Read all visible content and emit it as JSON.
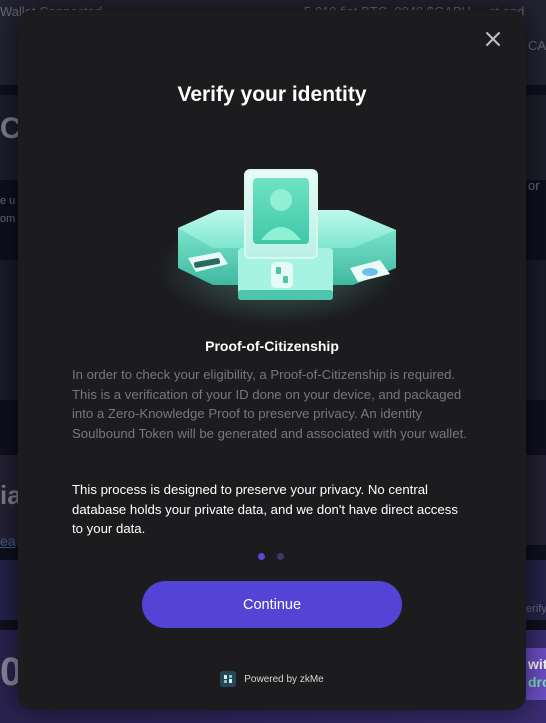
{
  "background": {
    "top_left": "Wallet Connected",
    "top_right": "5,019 fiat BTC, 0040 $GAPU ... ct and",
    "top_right2": "CA",
    "big_letter1": "C",
    "side_text1": "e u",
    "side_text2": "om",
    "right_text": "or",
    "big_letter2": "ia",
    "link_text": "ea",
    "right_text2": "erify",
    "big_number": "0",
    "purple_text1": "wit",
    "purple_text2": "dro"
  },
  "modal": {
    "title": "Verify your identity",
    "subtitle": "Proof-of-Citizenship",
    "description": "In order to check your eligibility, a Proof-of-Citizenship is required. This is a verification of your ID done on your device, and packaged into a Zero-Knowledge Proof to preserve privacy. An identity Soulbound Token will be generated and associated with your wallet.",
    "privacy_note": "This process is designed to preserve your privacy. No central database holds your private data, and we don't have direct access to your data.",
    "pagination": {
      "current": 1,
      "total": 2
    },
    "continue_label": "Continue",
    "powered_by": "Powered by zkMe",
    "colors": {
      "accent": "#5444d6",
      "modal_bg": "#1c1c1e",
      "illustration": "#7ff0d8"
    },
    "icons": {
      "close": "close-icon",
      "logo": "zkme-logo-icon"
    }
  }
}
